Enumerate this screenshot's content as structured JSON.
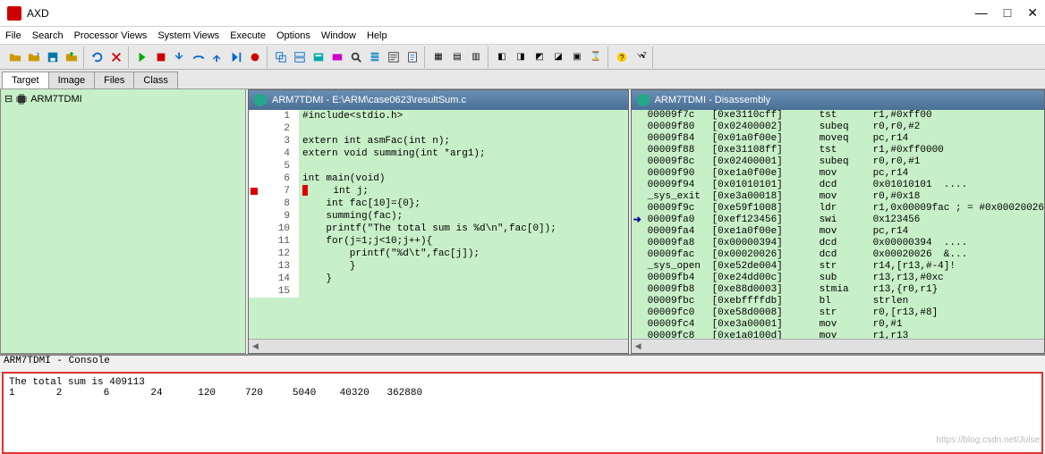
{
  "title": "AXD",
  "menu": [
    "File",
    "Search",
    "Processor Views",
    "System Views",
    "Execute",
    "Options",
    "Window",
    "Help"
  ],
  "sidebar_tabs": [
    "Target",
    "Image",
    "Files",
    "Class"
  ],
  "tree_root": "ARM7TDMI",
  "source_window_title": "ARM7TDMI - E:\\ARM\\case0623\\resultSum.c",
  "source_lines": [
    {
      "n": "1",
      "t": "#include<stdio.h>"
    },
    {
      "n": "2",
      "t": ""
    },
    {
      "n": "3",
      "t": "extern int asmFac(int n);"
    },
    {
      "n": "4",
      "t": "extern void summing(int *arg1);"
    },
    {
      "n": "5",
      "t": ""
    },
    {
      "n": "6",
      "t": "int main(void)"
    },
    {
      "n": "7",
      "t": "    int j;",
      "bp": true,
      "cur": true
    },
    {
      "n": "8",
      "t": "    int fac[10]={0};"
    },
    {
      "n": "9",
      "t": "    summing(fac);"
    },
    {
      "n": "10",
      "t": "    printf(\"The total sum is %d\\n\",fac[0]);"
    },
    {
      "n": "11",
      "t": "    for(j=1;j<10;j++){"
    },
    {
      "n": "12",
      "t": "        printf(\"%d\\t\",fac[j]);"
    },
    {
      "n": "13",
      "t": "        }"
    },
    {
      "n": "14",
      "t": "    }"
    },
    {
      "n": "15",
      "t": ""
    }
  ],
  "disasm_window_title": "ARM7TDMI - Disassembly",
  "disasm": [
    {
      "a": "00009f7c",
      "op": "[0xe3110cff]",
      "m": "tst",
      "p": "r1,#0xff00"
    },
    {
      "a": "00009f80",
      "op": "[0x02400002]",
      "m": "subeq",
      "p": "r0,r0,#2"
    },
    {
      "a": "00009f84",
      "op": "[0x01a0f00e]",
      "m": "moveq",
      "p": "pc,r14"
    },
    {
      "a": "00009f88",
      "op": "[0xe31108ff]",
      "m": "tst",
      "p": "r1,#0xff0000"
    },
    {
      "a": "00009f8c",
      "op": "[0x02400001]",
      "m": "subeq",
      "p": "r0,r0,#1"
    },
    {
      "a": "00009f90",
      "op": "[0xe1a0f00e]",
      "m": "mov",
      "p": "pc,r14"
    },
    {
      "a": "00009f94",
      "op": "[0x01010101]",
      "m": "dcd",
      "p": "0x01010101  ...."
    },
    {
      "a": "_sys_exit",
      "op": "[0xe3a00018]",
      "m": "mov",
      "p": "r0,#0x18"
    },
    {
      "a": "00009f9c",
      "op": "[0xe59f1008]",
      "m": "ldr",
      "p": "r1,0x00009fac ; = #0x00020026"
    },
    {
      "a": "00009fa0",
      "op": "[0xef123456]",
      "m": "swi",
      "p": "0x123456",
      "pc": true
    },
    {
      "a": "00009fa4",
      "op": "[0xe1a0f00e]",
      "m": "mov",
      "p": "pc,r14"
    },
    {
      "a": "00009fa8",
      "op": "[0x00000394]",
      "m": "dcd",
      "p": "0x00000394  ...."
    },
    {
      "a": "00009fac",
      "op": "[0x00020026]",
      "m": "dcd",
      "p": "0x00020026  &..."
    },
    {
      "a": "_sys_open",
      "op": "[0xe52de004]",
      "m": "str",
      "p": "r14,[r13,#-4]!"
    },
    {
      "a": "00009fb4",
      "op": "[0xe24dd00c]",
      "m": "sub",
      "p": "r13,r13,#0xc"
    },
    {
      "a": "00009fb8",
      "op": "[0xe88d0003]",
      "m": "stmia",
      "p": "r13,{r0,r1}"
    },
    {
      "a": "00009fbc",
      "op": "[0xebffffdb]",
      "m": "bl",
      "p": "strlen"
    },
    {
      "a": "00009fc0",
      "op": "[0xe58d0008]",
      "m": "str",
      "p": "r0,[r13,#8]"
    },
    {
      "a": "00009fc4",
      "op": "[0xe3a00001]",
      "m": "mov",
      "p": "r0,#1"
    },
    {
      "a": "00009fc8",
      "op": "[0xe1a0100d]",
      "m": "mov",
      "p": "r1,r13"
    }
  ],
  "console_title": "ARM7TDMI - Console",
  "console_line1": "The total sum is 409113",
  "console_line2": "1       2       6       24      120     720     5040    40320   362880",
  "watermark": "https://blog.csdn.net/Julse",
  "winbtns": {
    "min": "—",
    "max": "□",
    "close": "✕"
  }
}
